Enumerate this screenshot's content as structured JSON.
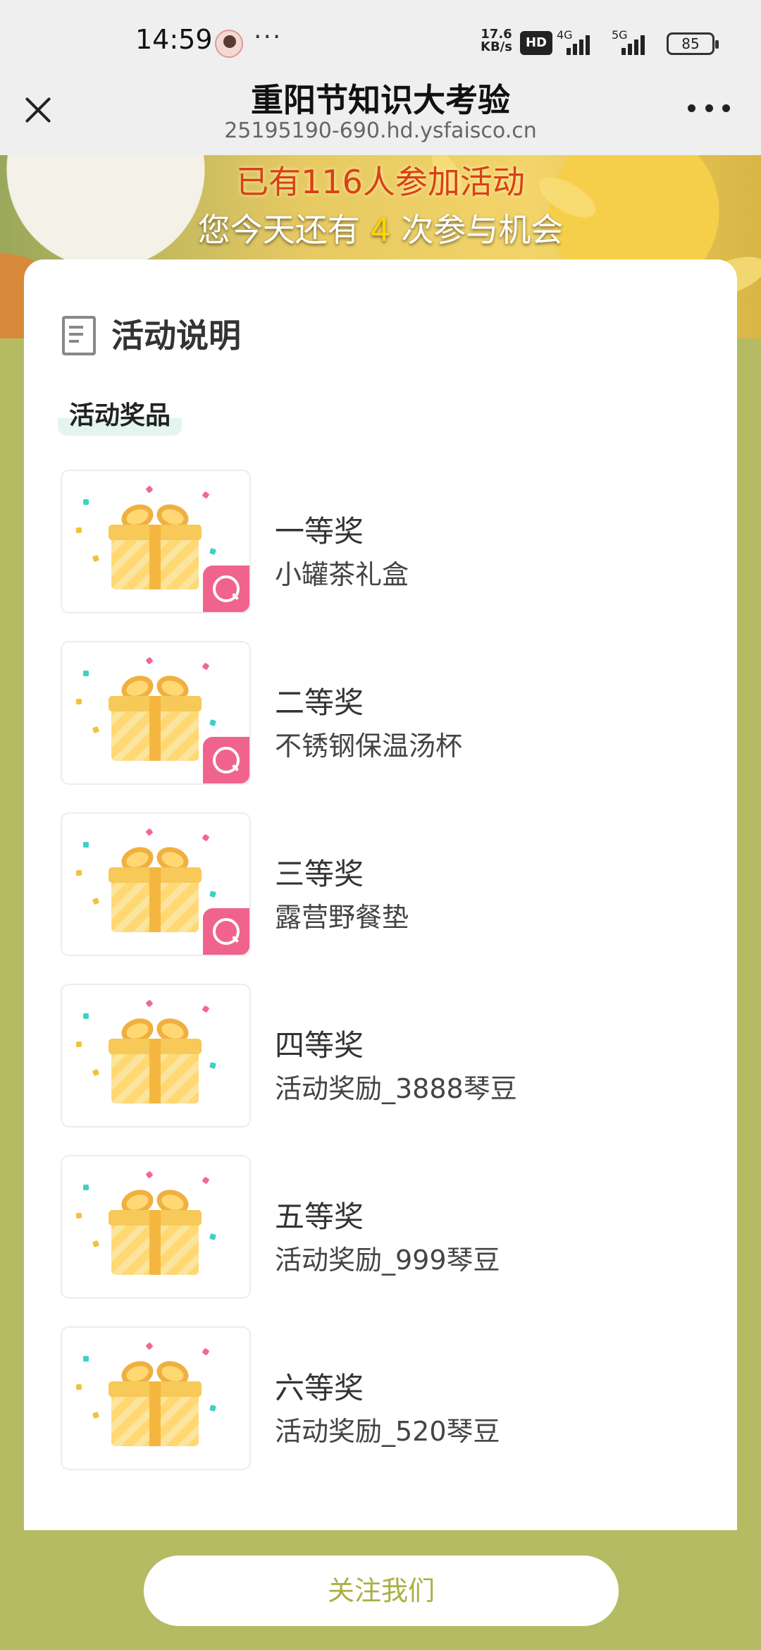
{
  "status_bar": {
    "time": "14:59",
    "more": "···",
    "net_speed_value": "17.6",
    "net_speed_unit": "KB/s",
    "hd": "HD",
    "sim1": "4G",
    "sim2": "5G",
    "battery": "85"
  },
  "nav": {
    "title": "重阳节知识大考验",
    "url": "25195190-690.hd.ysfaisco.cn"
  },
  "banner": {
    "participants": "已有116人参加活动",
    "chances_prefix": "您今天还有",
    "chances_count": "4",
    "chances_suffix": "次参与机会"
  },
  "section": {
    "title": "活动说明",
    "tag": "活动奖品"
  },
  "prizes": [
    {
      "level": "一等奖",
      "name": "小罐茶礼盒",
      "icon": "search-icon"
    },
    {
      "level": "二等奖",
      "name": "不锈钢保温汤杯",
      "icon": "search-icon"
    },
    {
      "level": "三等奖",
      "name": "露营野餐垫",
      "icon": "search-icon"
    },
    {
      "level": "四等奖",
      "name": "活动奖励_3888琴豆"
    },
    {
      "level": "五等奖",
      "name": "活动奖励_999琴豆"
    },
    {
      "level": "六等奖",
      "name": "活动奖励_520琴豆"
    }
  ],
  "footer": {
    "follow_label": "关注我们"
  },
  "colors": {
    "page_bg": "#b5bb62",
    "badge": "#f0638c",
    "highlight": "#ffd400",
    "participants_text": "#d9420f",
    "follow_text": "#aab045"
  }
}
